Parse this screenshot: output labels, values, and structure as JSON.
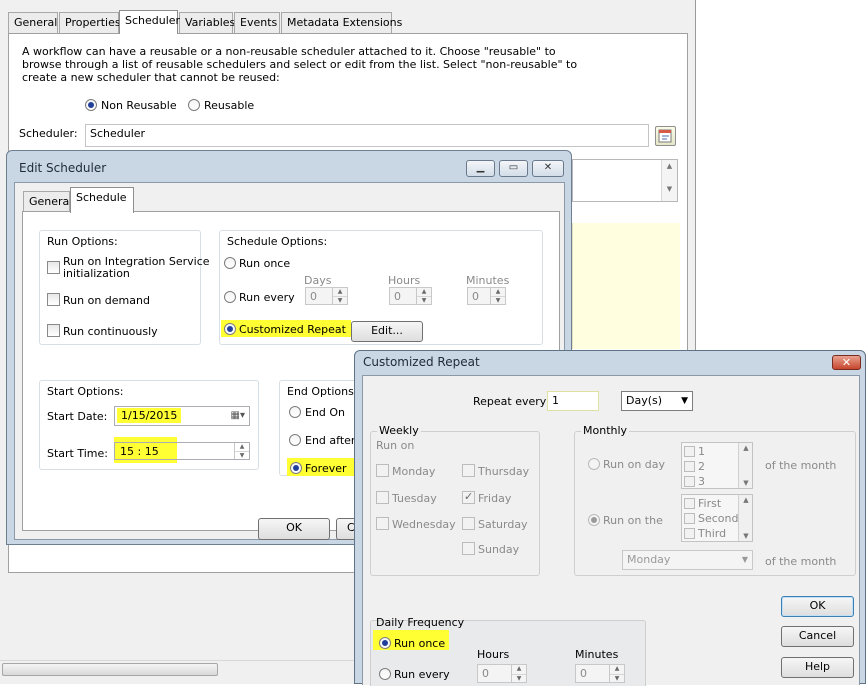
{
  "parent": {
    "tabs": [
      "General",
      "Properties",
      "Scheduler",
      "Variables",
      "Events",
      "Metadata Extensions"
    ],
    "active_tab": "Scheduler",
    "description_lines": [
      "A workflow can have a reusable or a non-reusable scheduler attached to it.  Choose \"reusable\" to",
      "browse through a list of reusable schedulers and select or edit from the list.  Select \"non-reusable\" to",
      "create a new scheduler that cannot be reused:"
    ],
    "radio_non_reusable": "Non Reusable",
    "radio_reusable": "Reusable",
    "scheduler_label": "Scheduler:",
    "scheduler_value": "Scheduler"
  },
  "edit_scheduler": {
    "title": "Edit Scheduler",
    "tabs": [
      "General",
      "Schedule"
    ],
    "active_tab": "Schedule",
    "run_options": {
      "title": "Run Options:",
      "integration_line1": "Run on Integration Service",
      "integration_line2": "initialization",
      "on_demand": "Run on demand",
      "continuously": "Run continuously"
    },
    "schedule_options": {
      "title": "Schedule Options:",
      "run_once": "Run once",
      "run_every": "Run every",
      "days": "Days",
      "hours": "Hours",
      "minutes": "Minutes",
      "days_value": "0",
      "hours_value": "0",
      "minutes_value": "0",
      "customized_repeat": "Customized Repeat",
      "edit_button": "Edit..."
    },
    "start_options": {
      "title": "Start Options:",
      "start_date_label": "Start Date:",
      "start_date": "1/15/2015",
      "start_time_label": "Start Time:",
      "start_time": "15 : 15"
    },
    "end_options": {
      "title": "End Options:",
      "end_on": "End On",
      "end_after": "End after",
      "forever": "Forever"
    },
    "ok_button": "OK",
    "cancel_partial": "C"
  },
  "customized_repeat": {
    "title": "Customized Repeat",
    "close_glyph": "✕",
    "repeat_every_label": "Repeat every",
    "repeat_every_value": "1",
    "unit_value": "Day(s)",
    "weekly": {
      "title": "Weekly",
      "run_on": "Run on",
      "days": [
        "Monday",
        "Tuesday",
        "Wednesday",
        "Thursday",
        "Friday",
        "Saturday",
        "Sunday"
      ]
    },
    "monthly": {
      "title": "Monthly",
      "run_on_day": "Run on day",
      "day_list": [
        "1",
        "2",
        "3"
      ],
      "of_the_month_1": "of the month",
      "run_on_the": "Run on the",
      "ordinal_list": [
        "First",
        "Second",
        "Third"
      ],
      "weekday_value": "Monday",
      "of_the_month_2": "of the month"
    },
    "daily": {
      "title": "Daily Frequency",
      "run_once": "Run once",
      "run_every": "Run every",
      "hours": "Hours",
      "minutes": "Minutes",
      "hours_value": "0",
      "minutes_value": "0"
    },
    "ok_button": "OK",
    "cancel_button": "Cancel",
    "help_button": "Help"
  }
}
